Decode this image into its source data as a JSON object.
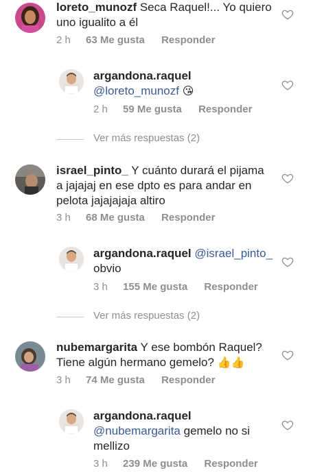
{
  "comments": [
    {
      "username": "loreto_munozf",
      "text_1": " Seca Raquel!... Yo quiero",
      "text_2": "uno igualito a él",
      "time": "2 h",
      "likes": "63 Me gusta",
      "reply": "Responder",
      "avatar_icon": "woman-avatar",
      "replies": [
        {
          "username": "argandona.raquel",
          "mention": "@loreto_munozf",
          "text": "",
          "emoji": "😘",
          "time": "2 h",
          "likes": "59 Me gusta",
          "reply": "Responder"
        }
      ],
      "more_replies": "Ver más respuestas (2)"
    },
    {
      "username": "israel_pinto_",
      "text_1": " Y cuánto durará el pijama",
      "text_2": "a jajajaj en ese dpto es para andar en",
      "text_3": "pelota jajajajaja altiro",
      "time": "3 h",
      "likes": "68 Me gusta",
      "reply": "Responder",
      "replies": [
        {
          "username": "argandona.raquel",
          "mention": " @israel_pinto_",
          "text": "obvio",
          "time": "3 h",
          "likes": "155 Me gusta",
          "reply": "Responder"
        }
      ],
      "more_replies": "Ver más respuestas (2)"
    },
    {
      "username": "nubemargarita",
      "text_1": " Y ese bombón Raquel?",
      "text_2": "Tiene algún hermano gemelo? ",
      "emoji": "👍👍",
      "time": "3 h",
      "likes": "74 Me gusta",
      "reply": "Responder",
      "replies": [
        {
          "username": "argandona.raquel",
          "mention": "@nubemargarita",
          "text_a": " gemelo no si",
          "text_b": "mellizo",
          "time": "3 h",
          "likes": "239 Me gusta",
          "reply": "Responder"
        }
      ]
    }
  ],
  "colors": {
    "text": "#262626",
    "meta": "#8e8e8e",
    "mention": "#3a5a99"
  },
  "icons": {
    "like": "heart-outline-icon",
    "reply_avatar": "man-avatar"
  }
}
